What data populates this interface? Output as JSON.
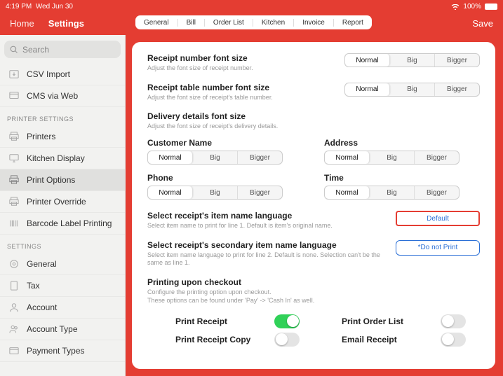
{
  "status": {
    "time": "4:19 PM",
    "date": "Wed Jun 30",
    "battery": "100%"
  },
  "header": {
    "home": "Home",
    "settings": "Settings",
    "save": "Save"
  },
  "tabs": [
    "General",
    "Bill",
    "Order List",
    "Kitchen",
    "Invoice",
    "Report"
  ],
  "active_tab": "Bill",
  "search_placeholder": "Search",
  "side": {
    "items1": [
      "CSV Import",
      "CMS via Web"
    ],
    "head1": "PRINTER SETTINGS",
    "items2": [
      "Printers",
      "Kitchen Display",
      "Print Options",
      "Printer Override",
      "Barcode Label Printing"
    ],
    "active": "Print Options",
    "head2": "SETTINGS",
    "items3": [
      "General",
      "Tax",
      "Account",
      "Account Type",
      "Payment Types"
    ]
  },
  "seg_labels": {
    "normal": "Normal",
    "big": "Big",
    "bigger": "Bigger"
  },
  "sections": {
    "rn": {
      "t": "Receipt number font size",
      "d": "Adjust the font size of receipt number."
    },
    "rtn": {
      "t": "Receipt table number font size",
      "d": "Adjust the font size of receipt's table number."
    },
    "dd": {
      "t": "Delivery details font size",
      "d": "Adjust the font size of receipt's delivery details."
    },
    "cust": "Customer Name",
    "addr": "Address",
    "phone": "Phone",
    "time": "Time",
    "lang1": {
      "t": "Select receipt's item name language",
      "d": "Select item name to print for line 1. Default is item's original name."
    },
    "lang1_btn": "Default",
    "lang2": {
      "t": "Select receipt's secondary item name language",
      "d": "Select item name language to print for line 2. Default is none. Selection can't be the same as line 1."
    },
    "lang2_btn": "*Do not Print",
    "chk": {
      "t": "Printing upon checkout",
      "d": "Configure the printing option upon checkout.\nThese options can be found under 'Pay' -> 'Cash In' as well."
    }
  },
  "toggles": {
    "pr": "Print Receipt",
    "pol": "Print Order List",
    "prc": "Print Receipt Copy",
    "er": "Email Receipt"
  }
}
